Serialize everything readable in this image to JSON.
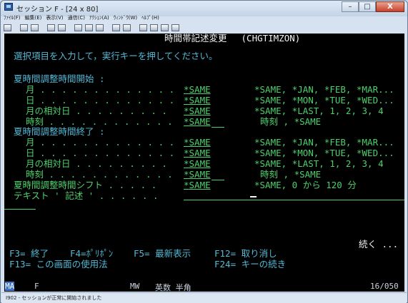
{
  "window": {
    "title": "セッション F - [24 x 80]",
    "buttons": {
      "minimize": "–",
      "maximize": "□",
      "close": "X"
    }
  },
  "menu": [
    "ﾌｧｲﾙ(F)",
    "編集(E)",
    "表示(V)",
    "通信(C)",
    "ｱｸｼｮﾝ(A)",
    "ｳｨﾝﾄﾞｳ(W)",
    "ﾍﾙﾌﾟ(H)"
  ],
  "toolbar_icons": [
    "print-icon",
    "copy-icon",
    "paste-icon",
    "send-icon",
    "receive-icon",
    "macro-icon",
    "record-icon",
    "play-icon",
    "stop-icon",
    "key-icon",
    "customize-icon",
    "palette-icon",
    "tip-icon",
    "help-icon"
  ],
  "screen": {
    "title": "時間帯記述変更　 (CHGTIMZON)",
    "instruction": "選択項目を入力して，実行キーを押してください。",
    "dst_start_heading": "夏時間調整時間開始 :",
    "dst_start": [
      {
        "label": "月 . . . . . . . . . . . . .",
        "value": "*SAME",
        "choices": "*SAME, *JAN, *FEB, *MAR..."
      },
      {
        "label": "日 . . . . . . . . . . . . .",
        "value": "*SAME",
        "choices": "*SAME, *MON, *TUE, *WED..."
      },
      {
        "label": "月の相対日 . . . . . . . . .",
        "value": "*SAME",
        "choices": "*SAME, *LAST, 1, 2, 3, 4"
      },
      {
        "label": "時刻 . . . . . . . . . . . .",
        "value": "*SAME",
        "choices": "時刻 , *SAME"
      }
    ],
    "dst_end_heading": "夏時間調整時間終了 :",
    "dst_end": [
      {
        "label": "月 . . . . . . . . . . . . .",
        "value": "*SAME",
        "choices": "*SAME, *JAN, *FEB, *MAR..."
      },
      {
        "label": "日 . . . . . . . . . . . . .",
        "value": "*SAME",
        "choices": "*SAME, *MON, *TUE, *WED..."
      },
      {
        "label": "月の相対日 . . . . . . . . .",
        "value": "*SAME",
        "choices": "*SAME, *LAST, 1, 2, 3, 4"
      },
      {
        "label": "時刻 . . . . . . . . . . . .",
        "value": "*SAME",
        "choices": "時刻 , *SAME"
      }
    ],
    "dst_shift": {
      "label": "夏時間調整時間シフト . . . . .",
      "value": "*SAME",
      "choices": "*SAME, 0 から 120 分"
    },
    "text_desc": {
      "label": "テキスト ' 記述 ' . . . . . .",
      "value": ""
    },
    "more": "続く ...",
    "fkeys": {
      "f3": "F3= 終了",
      "f4": "F4=ﾎﾟﾘﾎﾟﾝ",
      "f5": "F5= 最新表示",
      "f12": "F12= 取り消し",
      "f13": "F13= この画面の使用法",
      "f24": "F24= キーの続き"
    }
  },
  "oia": {
    "ma": "MA",
    "session": "F",
    "mw": "MW",
    "mode": "英数 半角",
    "cursor_pos": "16/050"
  },
  "status_message": "I902 - セッションが正常に開始されました"
}
